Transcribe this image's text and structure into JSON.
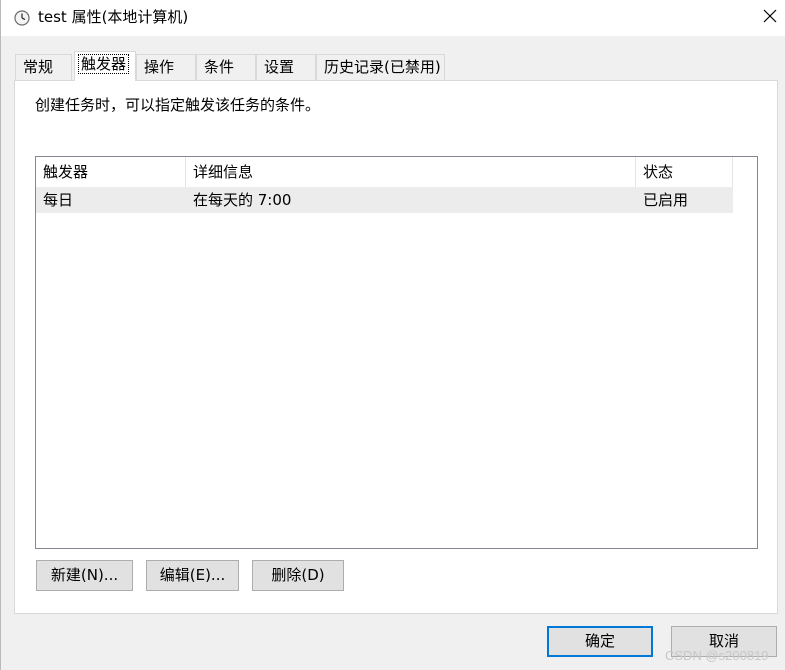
{
  "window": {
    "title": "test 属性(本地计算机)",
    "icon": "clock-icon",
    "close_symbol": "✕"
  },
  "tabs": [
    {
      "label": "常规",
      "active": false
    },
    {
      "label": "触发器",
      "active": true
    },
    {
      "label": "操作",
      "active": false
    },
    {
      "label": "条件",
      "active": false
    },
    {
      "label": "设置",
      "active": false
    },
    {
      "label": "历史记录(已禁用)",
      "active": false
    }
  ],
  "panel": {
    "description": "创建任务时，可以指定触发该任务的条件。",
    "list": {
      "columns": [
        "触发器",
        "详细信息",
        "状态"
      ],
      "rows": [
        [
          "每日",
          "在每天的 7:00",
          "已启用"
        ]
      ]
    },
    "buttons": {
      "new_label": "新建(N)...",
      "edit_label": "编辑(E)...",
      "delete_label": "删除(D)"
    }
  },
  "footer": {
    "ok_label": "确定",
    "cancel_label": "取消"
  },
  "watermark": "CSDN @s200819",
  "colors": {
    "accent": "#0078d7",
    "row_selected": "#ececec",
    "button_face": "#e1e1e1"
  }
}
